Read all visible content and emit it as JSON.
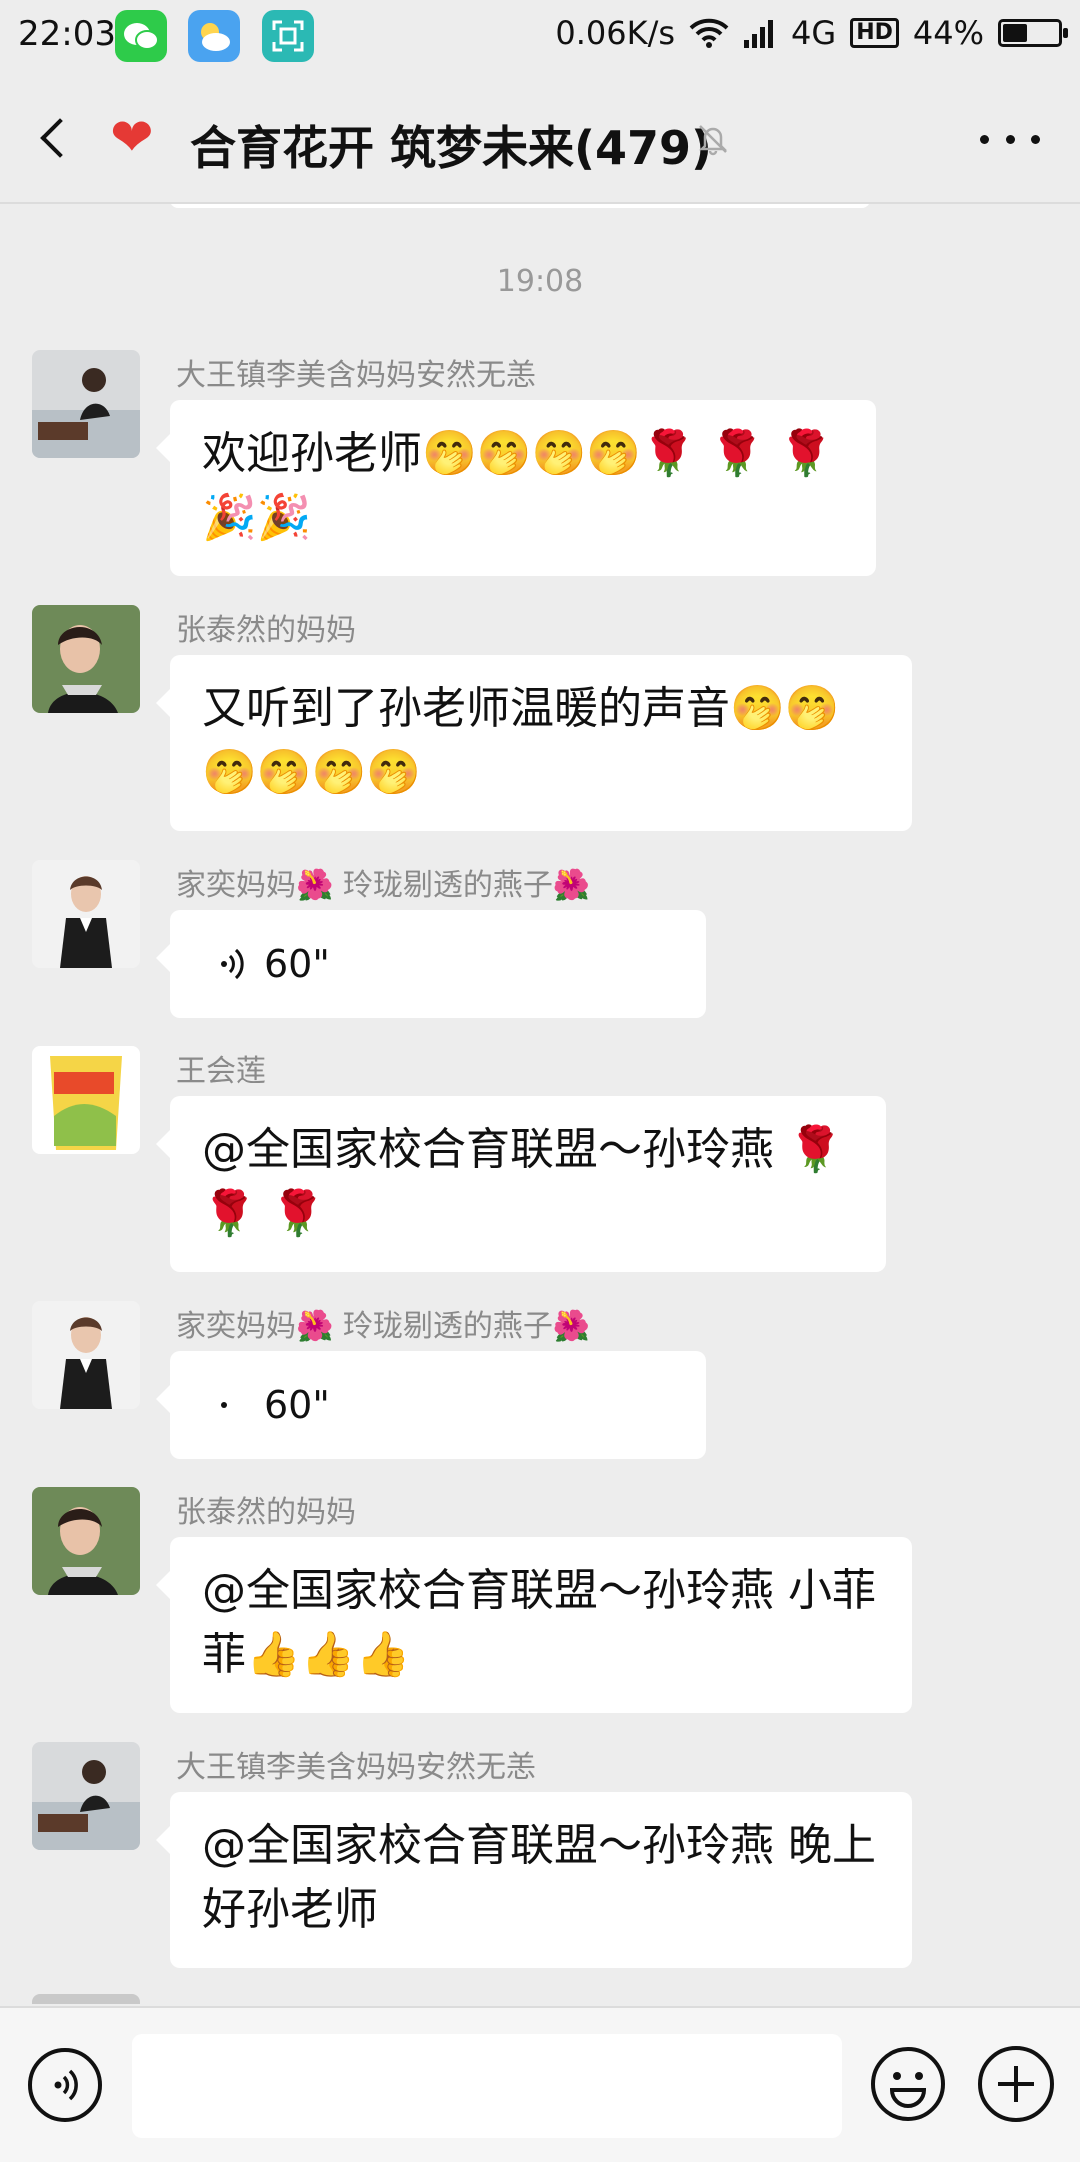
{
  "status_bar": {
    "time": "22:03",
    "net_speed": "0.06K/s",
    "network": "4G",
    "hd": "HD",
    "battery": "44%",
    "battery_level": 0.44
  },
  "header": {
    "title": "合育花开 筑梦未来(479)",
    "heart": "❤",
    "back_icon": "back-arrow-icon",
    "mute_icon": "mute-bell-icon",
    "more_icon": "more-dots-icon"
  },
  "chat": {
    "timestamp": "19:08",
    "messages": [
      {
        "sender": "大王镇李美含妈妈安然无恙",
        "text": "欢迎孙老师🤭🤭🤭🤭🌹 🌹 🌹 🎉🎉"
      },
      {
        "sender": "张泰然的妈妈",
        "text": "又听到了孙老师温暖的声音🤭🤭🤭🤭🤭🤭"
      },
      {
        "sender": "家奕妈妈🌺 玲珑剔透的燕子🌺",
        "voice": "60\""
      },
      {
        "sender": "王会莲",
        "text": "@全国家校合育联盟～孙玲燕 🌹 🌹 🌹"
      },
      {
        "sender": "家奕妈妈🌺 玲珑剔透的燕子🌺",
        "voice": "60\""
      },
      {
        "sender": "张泰然的妈妈",
        "text": "@全国家校合育联盟～孙玲燕  小菲菲👍👍👍"
      },
      {
        "sender": "大王镇李美含妈妈安然无恙",
        "text": "@全国家校合育联盟～孙玲燕  晚上好孙老师"
      }
    ]
  },
  "input_bar": {
    "voice_icon": "voice-toggle-icon",
    "emoji_icon": "emoji-icon",
    "plus_icon": "plus-icon"
  }
}
